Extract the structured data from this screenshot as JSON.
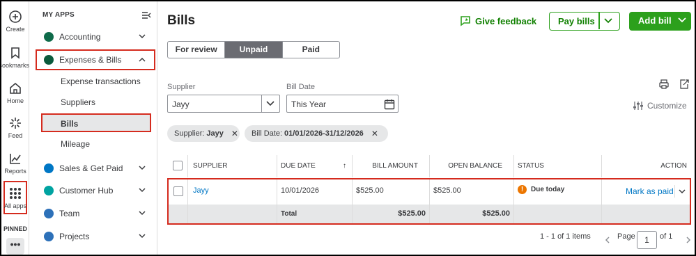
{
  "rail": {
    "items": [
      {
        "label": "Create",
        "icon": "plus-circle-icon"
      },
      {
        "label": "Bookmarks",
        "icon": "bookmark-icon"
      },
      {
        "label": "Home",
        "icon": "home-icon"
      },
      {
        "label": "Feed",
        "icon": "sparkle-icon"
      },
      {
        "label": "Reports",
        "icon": "chart-line-icon"
      },
      {
        "label": "All apps",
        "icon": "grid-icon"
      }
    ],
    "pinned_label": "PINNED",
    "more_label": "•••"
  },
  "menu": {
    "header": "MY APPS",
    "items": [
      {
        "label": "Accounting",
        "color": "#0f6b4a"
      },
      {
        "label": "Expenses & Bills",
        "color": "#0a5a3c"
      },
      {
        "label": "Sales & Get Paid",
        "color": "#0077c5"
      },
      {
        "label": "Customer Hub",
        "color": "#00a3a1"
      },
      {
        "label": "Team",
        "color": "#2d71b9"
      },
      {
        "label": "Projects",
        "color": "#2d71b9"
      }
    ],
    "sub_items": [
      "Expense transactions",
      "Suppliers",
      "Bills",
      "Mileage"
    ]
  },
  "page": {
    "title": "Bills",
    "feedback_label": "Give feedback",
    "pay_bills_label": "Pay bills",
    "add_bill_label": "Add bill",
    "tabs": [
      "For review",
      "Unpaid",
      "Paid"
    ],
    "active_tab": "Unpaid"
  },
  "filters": {
    "supplier_label": "Supplier",
    "supplier_value": "Jayy",
    "bill_date_label": "Bill Date",
    "bill_date_value": "This Year",
    "customize_label": "Customize",
    "chips": [
      {
        "key": "Supplier:",
        "value": "Jayy"
      },
      {
        "key": "Bill Date:",
        "value": "01/01/2026-31/12/2026"
      }
    ]
  },
  "table": {
    "headers": [
      "SUPPLIER",
      "DUE DATE",
      "BILL AMOUNT",
      "OPEN BALANCE",
      "STATUS",
      "ACTION"
    ],
    "sort_indicator": "↑",
    "row": {
      "supplier": "Jayy",
      "due_date": "10/01/2026",
      "bill_amount": "$525.00",
      "open_balance": "$525.00",
      "status": "Due today",
      "action": "Mark as paid"
    },
    "total": {
      "label": "Total",
      "bill_amount": "$525.00",
      "open_balance": "$525.00"
    }
  },
  "pager": {
    "range": "1 - 1 of 1 items",
    "page_label": "Page",
    "page_value": "1",
    "of_label": "of 1"
  },
  "colors": {
    "accent": "#2ca01c",
    "highlight": "#d52b1e"
  }
}
